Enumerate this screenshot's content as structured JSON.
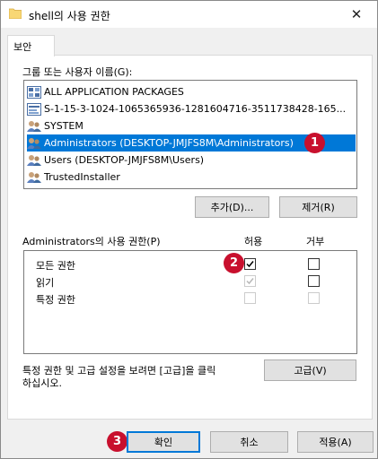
{
  "window": {
    "title": "shell의 사용 권한",
    "close_glyph": "✕"
  },
  "tabs": [
    {
      "label": "보안",
      "active": true
    }
  ],
  "groups": {
    "label": "그룹 또는 사용자 이름(G):",
    "items": [
      {
        "name": "ALL APPLICATION PACKAGES",
        "icon": "package-icon",
        "selected": false
      },
      {
        "name": "S-1-15-3-1024-1065365936-1281604716-3511738428-165...",
        "icon": "sid-icon",
        "selected": false
      },
      {
        "name": "SYSTEM",
        "icon": "users-icon",
        "selected": false
      },
      {
        "name": "Administrators (DESKTOP-JMJFS8M\\Administrators)",
        "icon": "users-icon",
        "selected": true
      },
      {
        "name": "Users (DESKTOP-JMJFS8M\\Users)",
        "icon": "users-icon",
        "selected": false
      },
      {
        "name": "TrustedInstaller",
        "icon": "users-icon",
        "selected": false
      }
    ],
    "add_button": "추가(D)...",
    "remove_button": "제거(R)"
  },
  "permissions": {
    "label": "Administrators의 사용 권한(P)",
    "allow_header": "허용",
    "deny_header": "거부",
    "rows": [
      {
        "name": "모든 권한",
        "allow": true,
        "allow_disabled": false,
        "deny": false,
        "deny_disabled": false
      },
      {
        "name": "읽기",
        "allow": true,
        "allow_disabled": true,
        "deny": false,
        "deny_disabled": false
      },
      {
        "name": "특정 권한",
        "allow": false,
        "allow_disabled": true,
        "deny": false,
        "deny_disabled": true
      }
    ]
  },
  "advanced": {
    "text_line1": "특정 권한 및 고급 설정을 보려면 [고급]을 클릭",
    "text_line2": "하십시오.",
    "button": "고급(V)"
  },
  "footer": {
    "ok": "확인",
    "cancel": "취소",
    "apply": "적용(A)"
  },
  "annotations": [
    "1",
    "2",
    "3"
  ],
  "colors": {
    "selection": "#0078d7",
    "badge": "#c8102e",
    "focus_border": "#0078d7"
  }
}
